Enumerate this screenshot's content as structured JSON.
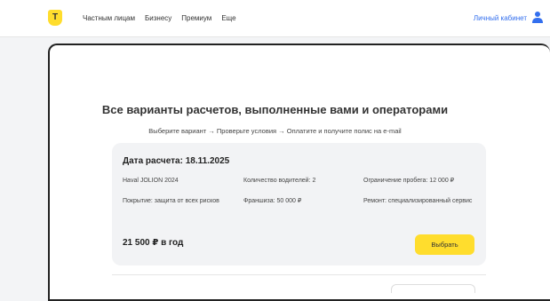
{
  "header": {
    "nav": [
      "Частным лицам",
      "Бизнесу",
      "Премиум",
      "Еще"
    ],
    "logo_letter": "T",
    "cabinet_label": "Личный кабинет",
    "brand_color": "#ffdd2d",
    "link_color": "#336fee"
  },
  "main": {
    "title": "Все варианты расчетов, выполненные вами и операторами",
    "subtitle": "Выберите вариант → Проверьте условия → Оплатите и получите полис на e-mail"
  },
  "calculation": {
    "date_label": "Дата расчета: 18.11.2025",
    "car": "Haval JOLION 2024",
    "drivers": "Количество водителей: 2",
    "mileage": "Ограничение пробега: 12 000 ₽",
    "coverage": "Покрытие: защита от всех рисков",
    "deductible": "Франшиза: 50 000 ₽",
    "repair": "Ремонт: специализированный сервис",
    "price": "21 500 ₽ в год",
    "choose_label": "Выбрать"
  }
}
